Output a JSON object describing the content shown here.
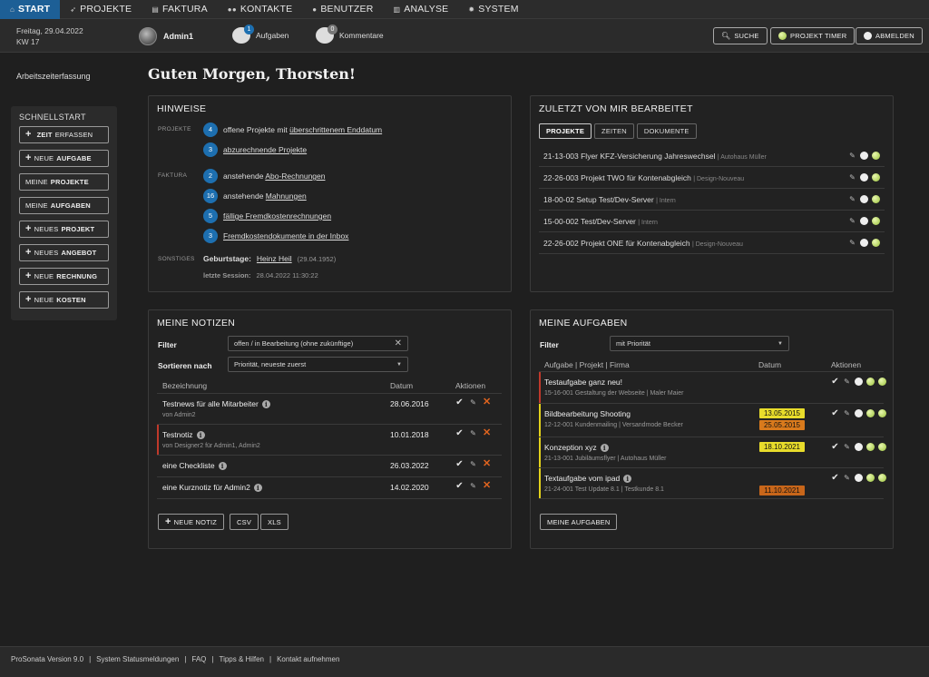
{
  "nav": {
    "items": [
      {
        "icon": "home-icon",
        "label": "START"
      },
      {
        "icon": "rocket-icon",
        "label": "PROJEKTE"
      },
      {
        "icon": "invoice-icon",
        "label": "FAKTURA"
      },
      {
        "icon": "contacts-icon",
        "label": "KONTAKTE"
      },
      {
        "icon": "user-icon",
        "label": "BENUTZER"
      },
      {
        "icon": "chart-icon",
        "label": "ANALYSE"
      },
      {
        "icon": "gear-icon",
        "label": "SYSTEM"
      }
    ]
  },
  "subbar": {
    "date": "Freitag, 29.04.2022",
    "week": "KW 17",
    "user": "Admin1",
    "tasks_label": "Aufgaben",
    "tasks_count": "1",
    "comments_label": "Kommentare",
    "comments_count": "0",
    "search": "SUCHE",
    "timer": "PROJEKT TIMER",
    "logout": "ABMELDEN"
  },
  "sidebar": {
    "link": "Arbeitszeiterfassung",
    "quick_title": "SCHNELLSTART",
    "buttons": [
      {
        "plus": true,
        "a": "",
        "b": "ZEIT",
        "c": " ERFASSEN"
      },
      {
        "plus": true,
        "a": "NEUE ",
        "b": "AUFGABE",
        "c": ""
      },
      {
        "plus": false,
        "a": "MEINE ",
        "b": "PROJEKTE",
        "c": ""
      },
      {
        "plus": false,
        "a": "MEINE ",
        "b": "AUFGABEN",
        "c": ""
      },
      {
        "plus": true,
        "a": "NEUES ",
        "b": "PROJEKT",
        "c": ""
      },
      {
        "plus": true,
        "a": "NEUES ",
        "b": "ANGEBOT",
        "c": ""
      },
      {
        "plus": true,
        "a": "NEUE ",
        "b": "RECHNUNG",
        "c": ""
      },
      {
        "plus": true,
        "a": "NEUE ",
        "b": "KOSTEN",
        "c": ""
      }
    ]
  },
  "greeting": "Guten Morgen, Thorsten!",
  "hinweise": {
    "title": "HINWEISE",
    "label_projekte": "PROJEKTE",
    "label_faktura": "FAKTURA",
    "label_sonstiges": "SONSTIGES",
    "rows": [
      {
        "count": "4",
        "pre": "offene Projekte mit ",
        "link": "überschrittenem Enddatum",
        "post": ""
      },
      {
        "count": "3",
        "pre": "",
        "link": "abzurechnende Projekte",
        "post": ""
      },
      {
        "count": "2",
        "pre": "anstehende ",
        "link": "Abo-Rechnungen",
        "post": ""
      },
      {
        "count": "16",
        "pre": "anstehende ",
        "link": "Mahnungen",
        "post": ""
      },
      {
        "count": "5",
        "pre": "",
        "link": "fällige Fremdkostenrechnungen",
        "post": ""
      },
      {
        "count": "3",
        "pre": "",
        "link": "Fremdkostendokumente in der Inbox",
        "post": ""
      }
    ],
    "birthday_label": "Geburtstage:",
    "birthday_name": "Heinz Heil",
    "birthday_date": "(29.04.1952)",
    "session_label": "letzte Session:",
    "session_value": "28.04.2022 11:30:22"
  },
  "recent": {
    "title": "ZULETZT VON MIR BEARBEITET",
    "tabs": [
      "PROJEKTE",
      "ZEITEN",
      "DOKUMENTE"
    ],
    "items": [
      {
        "name": "21-13-003 Flyer KFZ-Versicherung Jahreswechsel",
        "client": "| Autohaus Müller"
      },
      {
        "name": "22-26-003 Projekt TWO für Kontenabgleich",
        "client": "| Design-Nouveau"
      },
      {
        "name": "18-00-02 Setup Test/Dev-Server",
        "client": "| Intern"
      },
      {
        "name": "15-00-002 Test/Dev-Server",
        "client": "| Intern"
      },
      {
        "name": "22-26-002 Projekt ONE für Kontenabgleich",
        "client": "| Design-Nouveau"
      }
    ]
  },
  "notes": {
    "title": "MEINE NOTIZEN",
    "filter_label": "Filter",
    "filter_value": "offen / in Bearbeitung (ohne zukünftige)",
    "sort_label": "Sortieren nach",
    "sort_value": "Priorität, neueste zuerst",
    "col_name": "Bezeichnung",
    "col_date": "Datum",
    "col_actions": "Aktionen",
    "rows": [
      {
        "title": "Testnews für alle Mitarbeiter",
        "sub": "von Admin2",
        "date": "28.06.2016",
        "mark": ""
      },
      {
        "title": "Testnotiz",
        "sub": "von Designer2 für Admin1, Admin2",
        "date": "10.01.2018",
        "mark": "#c0392b"
      },
      {
        "title": "eine Checkliste",
        "sub": "",
        "date": "26.03.2022",
        "mark": ""
      },
      {
        "title": "eine Kurznotiz für Admin2",
        "sub": "",
        "date": "14.02.2020",
        "mark": ""
      }
    ],
    "btn_new": "NEUE NOTIZ",
    "btn_csv": "CSV",
    "btn_xls": "XLS"
  },
  "tasks": {
    "title": "MEINE AUFGABEN",
    "filter_label": "Filter",
    "filter_value": "mit Priorität",
    "col_name": "Aufgabe | Projekt | Firma",
    "col_date": "Datum",
    "col_actions": "Aktionen",
    "rows": [
      {
        "title": "Testaufgabe ganz neu!",
        "sub": "15-16-001 Gestaltung der Webseite | Maler Maier",
        "mark": "#c0392b",
        "dates": [],
        "info": false
      },
      {
        "title": "Bildbearbeitung Shooting",
        "sub": "12-12-001 Kundenmailing | Versandmode Becker",
        "mark": "#e3d21b",
        "dates": [
          {
            "d": "13.05.2015",
            "c": "#e8dc2b"
          },
          {
            "d": "25.05.2015",
            "c": "#d97a1c"
          }
        ],
        "info": false
      },
      {
        "title": "Konzeption xyz",
        "sub": "21-13-001 Jubiläumsflyer | Autohaus Müller",
        "mark": "#e3d21b",
        "dates": [
          {
            "d": "18.10.2021",
            "c": "#e8dc2b"
          }
        ],
        "info": true
      },
      {
        "title": "Textaufgabe vom ipad",
        "sub": "21-24-001 Test Update 8.1 | Testkunde 8.1",
        "mark": "#e3d21b",
        "dates": [
          {
            "d": "11.10.2021",
            "c": "#c8661a"
          }
        ],
        "info": true
      }
    ],
    "btn_all": "MEINE AUFGABEN"
  },
  "footer": [
    "ProSonata Version 9.0",
    "|",
    "System Statusmeldungen",
    "|",
    "FAQ",
    "|",
    "Tipps & Hilfen",
    "|",
    "Kontakt aufnehmen"
  ]
}
